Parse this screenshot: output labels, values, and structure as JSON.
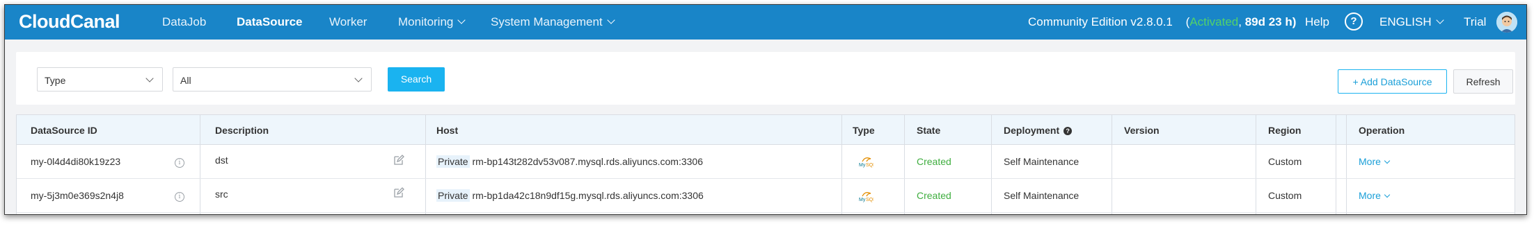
{
  "header": {
    "logo_text": "CloudCanal",
    "nav": [
      {
        "label": "DataJob",
        "active": false,
        "dropdown": false
      },
      {
        "label": "DataSource",
        "active": true,
        "dropdown": false
      },
      {
        "label": "Worker",
        "active": false,
        "dropdown": false
      },
      {
        "label": "Monitoring",
        "active": false,
        "dropdown": true
      },
      {
        "label": "System Management",
        "active": false,
        "dropdown": true
      }
    ],
    "edition": "Community Edition v2.8.0.1",
    "license_open": "(",
    "license_status": "Activated",
    "license_sep": ", ",
    "license_remaining": "89d 23 h)",
    "help_label": "Help",
    "help_icon_glyph": "?",
    "language": "ENGLISH",
    "user": "Trial"
  },
  "filter": {
    "type_select": "Type",
    "value_select": "All",
    "search_label": "Search",
    "add_label": "+ Add DataSource",
    "refresh_label": "Refresh"
  },
  "table": {
    "columns": [
      "DataSource ID",
      "Description",
      "Host",
      "Type",
      "State",
      "Deployment",
      "Version",
      "Region",
      "Operation"
    ],
    "rows": [
      {
        "id": "my-0l4d4di80k19z23",
        "description": "dst",
        "host_tag": "Private",
        "host": "rm-bp143t282dv53v087.mysql.rds.aliyuncs.com:3306",
        "type_icon": "mysql-icon",
        "state": "Created",
        "deployment": "Self Maintenance",
        "version": "",
        "region": "Custom",
        "operation": "More"
      },
      {
        "id": "my-5j3m0e369s2n4j8",
        "description": "src",
        "host_tag": "Private",
        "host": "rm-bp1da42c18n9df15g.mysql.rds.aliyuncs.com:3306",
        "type_icon": "mysql-icon",
        "state": "Created",
        "deployment": "Self Maintenance",
        "version": "",
        "region": "Custom",
        "operation": "More"
      }
    ]
  },
  "colors": {
    "nav_bg": "#1985c8",
    "primary": "#1ab3f0",
    "activated": "#52d26a",
    "created": "#3fae3f"
  }
}
